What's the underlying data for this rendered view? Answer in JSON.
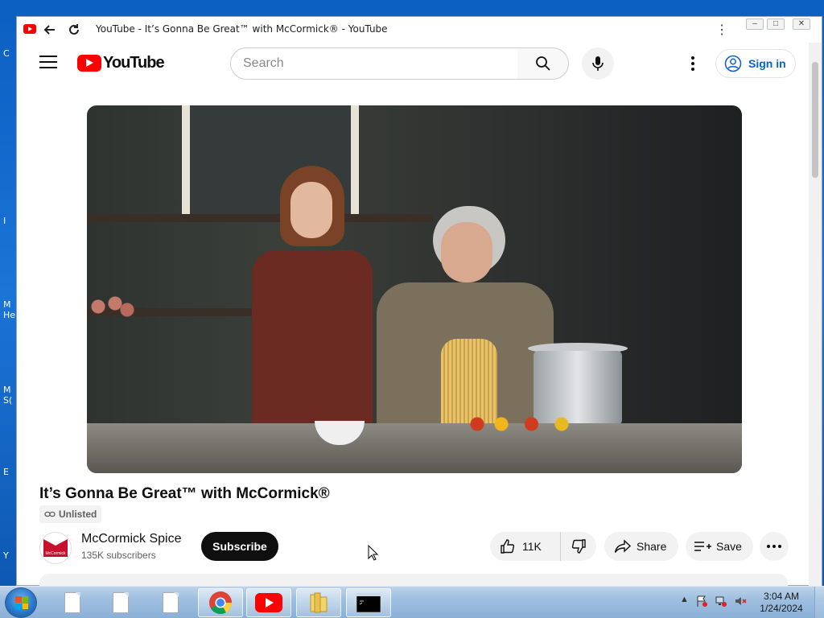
{
  "desktop": {
    "icon_labels": [
      "C",
      "I",
      "M He",
      "M S(",
      "E",
      "Y"
    ]
  },
  "browser": {
    "tab_title": "YouTube - It’s Gonna Be Great™ with McCormick® - YouTube",
    "window_controls": [
      "–",
      "□",
      "✕"
    ]
  },
  "masthead": {
    "logo_text": "YouTube",
    "search_placeholder": "Search",
    "sign_in_label": "Sign in"
  },
  "video": {
    "title": "It’s Gonna Be Great™ with McCormick®",
    "visibility_badge": "Unlisted"
  },
  "channel": {
    "name": "McCormick Spice",
    "subscribers": "135K subscribers",
    "avatar_text": "McCormick",
    "subscribe_label": "Subscribe"
  },
  "actions": {
    "like_count": "11K",
    "share_label": "Share",
    "save_label": "Save"
  },
  "taskbar": {
    "time": "3:04 AM",
    "date": "1/24/2024"
  },
  "colors": {
    "youtube_red": "#ff0000",
    "link_blue": "#065fd4",
    "subscribe_bg": "#0f0f0f"
  }
}
